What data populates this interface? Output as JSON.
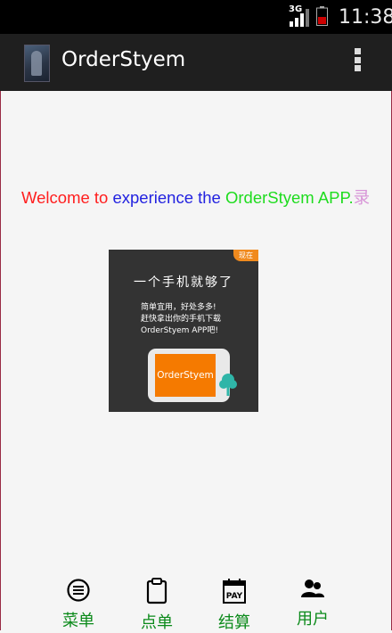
{
  "status_bar": {
    "network": "3G",
    "time": "11:38"
  },
  "action_bar": {
    "title": "OrderStyem",
    "overflow_icon": "overflow-menu-icon"
  },
  "welcome": {
    "part1": "Welcome to ",
    "part2": "experience the ",
    "part3": "OrderStyem APP.",
    "part4": "录"
  },
  "promo": {
    "corner_tag": "现在",
    "headline": "一个手机就够了",
    "line1": "简单宜用，好处多多!",
    "line2": "赶快拿出你的手机下载",
    "line3": "OrderStyem APP吧!",
    "phone_label": "OrderStyem"
  },
  "bottom_nav": {
    "items": [
      {
        "label": "菜单",
        "icon": "menu-list-icon"
      },
      {
        "label": "点单",
        "icon": "clipboard-icon"
      },
      {
        "label": "结算",
        "icon": "pay-calendar-icon"
      },
      {
        "label": "用户",
        "icon": "users-icon"
      }
    ]
  },
  "colors": {
    "accent_green": "#0b8a1a",
    "welcome_red": "#ff1e1e",
    "welcome_blue": "#2222e0",
    "welcome_green": "#1edc1e"
  }
}
